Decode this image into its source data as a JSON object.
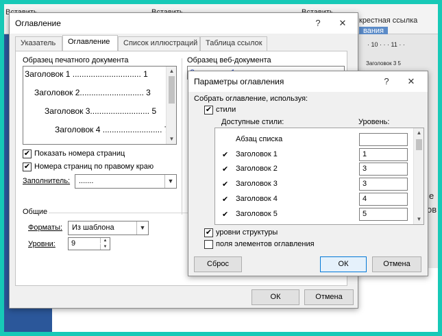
{
  "background": {
    "ribbon_insert_1": "Вставить",
    "ribbon_insert_2": "Вставить",
    "ribbon_insert_3": "Вставить",
    "ribbon_crossref": "крестная ссылка",
    "ribbon_group": "вания",
    "ruler_text": "· 10 · · · 11 · ·",
    "doc_fragment": "Заголовок 3 5",
    "right_letter_1": "е",
    "right_letter_2": "ов"
  },
  "toc_dialog": {
    "title": "Оглавление",
    "help": "?",
    "close": "✕",
    "tabs": [
      "Указатель",
      "Оглавление",
      "Список иллюстраций",
      "Таблица ссылок"
    ],
    "print_preview_label": "Образец печатного документа",
    "print_lines": [
      "Заголовок 1 .............................. 1",
      "Заголовок 2............................ 3",
      "Заголовок 3.......................... 5",
      "Заголовок 4 .......................... 7"
    ],
    "web_preview_label": "Образец веб-документа",
    "web_first_link": "Заголовок 1",
    "show_page_numbers": "Показать номера страниц",
    "right_align": "Номера страниц по правому краю",
    "filler_label": "Заполнитель:",
    "filler_value": ".......",
    "general_label": "Общие",
    "formats_label": "Форматы:",
    "formats_value": "Из шаблона",
    "levels_label": "Уровни:",
    "levels_value": "9",
    "ok": "ОК",
    "cancel": "Отмена"
  },
  "options_dialog": {
    "title": "Параметры оглавления",
    "help": "?",
    "close": "✕",
    "build_label": "Собрать оглавление, используя:",
    "styles_check": "стили",
    "available_styles_label": "Доступные стили:",
    "level_label": "Уровень:",
    "styles": [
      {
        "name": "Абзац списка",
        "checked": "",
        "level": ""
      },
      {
        "name": "Заголовок 1",
        "checked": "✔",
        "level": "1"
      },
      {
        "name": "Заголовок 2",
        "checked": "✔",
        "level": "3"
      },
      {
        "name": "Заголовок 3",
        "checked": "✔",
        "level": "3"
      },
      {
        "name": "Заголовок 4",
        "checked": "✔",
        "level": "4"
      },
      {
        "name": "Заголовок 5",
        "checked": "✔",
        "level": "5"
      }
    ],
    "outline_levels": "уровни структуры",
    "toc_fields": "поля элементов оглавления",
    "reset": "Сброс",
    "ok": "ОК",
    "cancel": "Отмена",
    "check_mark": "✔"
  }
}
